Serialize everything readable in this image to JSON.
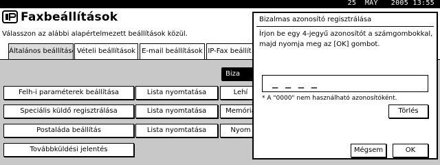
{
  "status_bar": {
    "datetime": "25  MAY   2005 13:55"
  },
  "header": {
    "icon": "fax-settings-icon",
    "title": "Faxbeállítások"
  },
  "instruction": "Válasszon az alábbi alapértelmezett beállítások közül.",
  "tabs": [
    {
      "label": "Általános beállítások",
      "selected": true
    },
    {
      "label": "Vételi beállítások",
      "selected": false
    },
    {
      "label": "E-mail beállítások",
      "selected": false
    },
    {
      "label": "IP-Fax beállít",
      "selected": false
    }
  ],
  "main": {
    "partial_dark_button": "Biza",
    "buttons": [
      "Felh-i paraméterek beállítása",
      "Lista nyomtatása",
      "Lehí",
      "Speciális küldő regisztrálása",
      "Lista nyomtatása",
      "Memória",
      "Postaláda beállítás",
      "Lista nyomtatása",
      "Nyom",
      "Továbbküldési jelentés"
    ]
  },
  "dialog": {
    "title": "Bizalmas azonosító regisztrálása",
    "message_line1": "Írjon be egy 4-jegyű azonosítót a számgombokkal,",
    "message_line2": "majd nyomja meg az [OK] gombot.",
    "input_value": "_ _ _ _",
    "note": "* A \"0000\" nem használható azonosítóként.",
    "clear_label": "Törlés",
    "cancel_label": "Mégsem",
    "ok_label": "OK"
  }
}
